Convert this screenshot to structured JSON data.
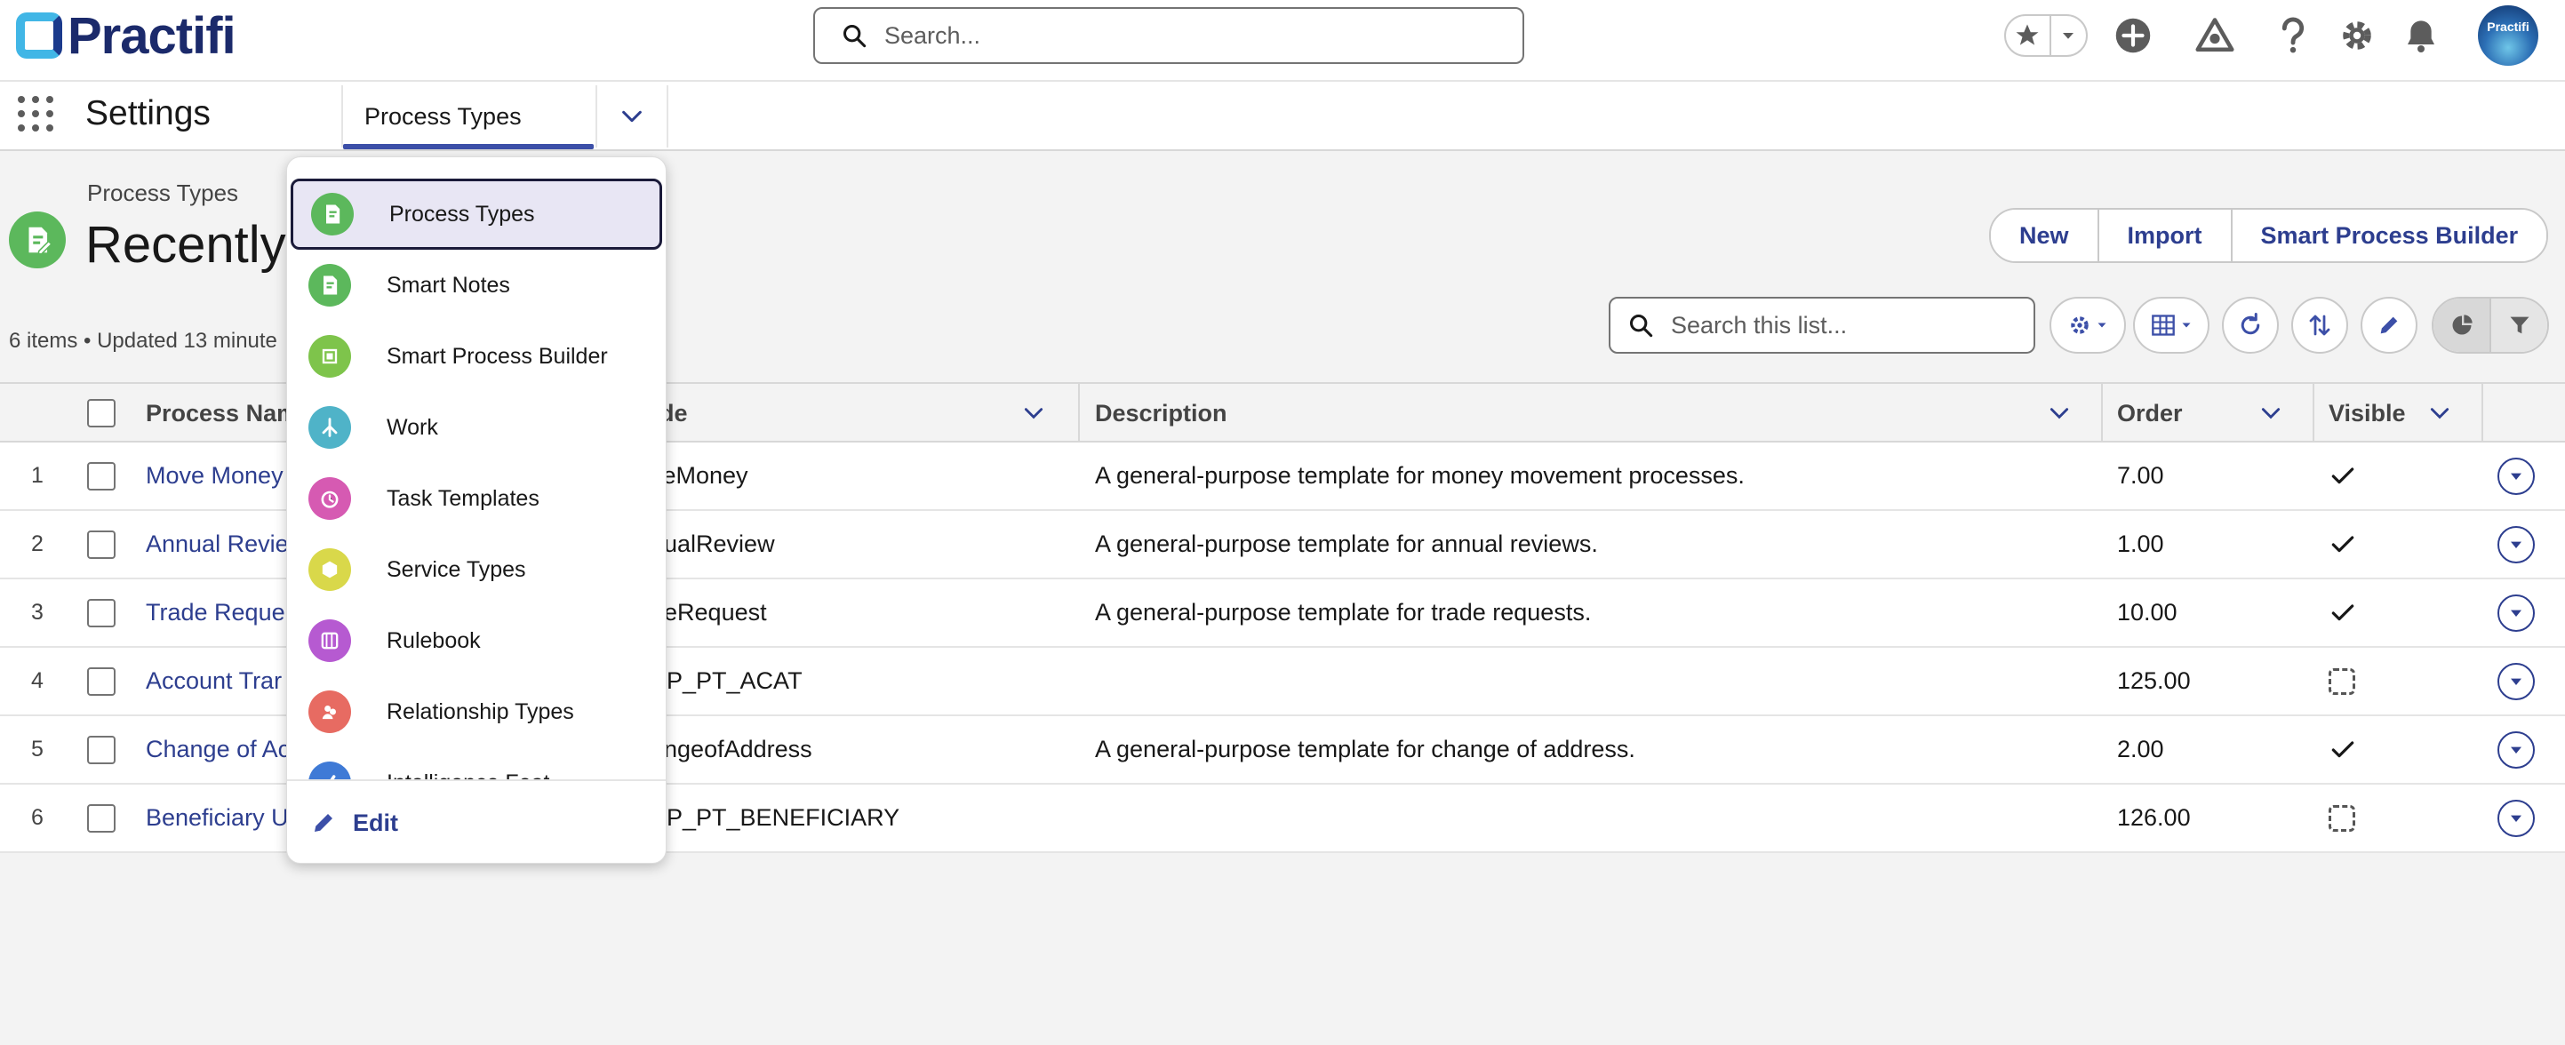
{
  "header": {
    "logo_text": "Practifi",
    "search_placeholder": "Search...",
    "avatar_text": "Practifi",
    "icons": [
      "favorites-star-icon",
      "favorites-dropdown-icon",
      "global-actions-icon",
      "trailhead-icon",
      "help-icon",
      "setup-gear-icon",
      "notifications-bell-icon"
    ]
  },
  "nav": {
    "app_name": "Settings",
    "tab_label": "Process Types"
  },
  "list": {
    "kicker": "Process Types",
    "title": "Recently",
    "meta": "6 items • Updated 13 minute",
    "buttons": {
      "new": "New",
      "import": "Import",
      "smart_builder": "Smart Process Builder"
    },
    "search_placeholder": "Search this list..."
  },
  "table": {
    "headers": {
      "name": "Process Nam",
      "code": "de",
      "description": "Description",
      "order": "Order",
      "visible": "Visible"
    },
    "rows": [
      {
        "num": "1",
        "name": "Move Money",
        "code": "veMoney",
        "description": "A general-purpose template for money movement processes.",
        "order": "7.00",
        "visible": true
      },
      {
        "num": "2",
        "name": "Annual Revie",
        "code": "nualReview",
        "description": "A general-purpose template for annual reviews.",
        "order": "1.00",
        "visible": true
      },
      {
        "num": "3",
        "name": "Trade Reque",
        "code": "deRequest",
        "description": "A general-purpose template for trade requests.",
        "order": "10.00",
        "visible": true
      },
      {
        "num": "4",
        "name": "Account Trar",
        "code": "VP_PT_ACAT",
        "description": "",
        "order": "125.00",
        "visible": false
      },
      {
        "num": "5",
        "name": "Change of Ac",
        "code": "angeofAddress",
        "description": "A general-purpose template for change of address.",
        "order": "2.00",
        "visible": true
      },
      {
        "num": "6",
        "name": "Beneficiary U",
        "code": "VP_PT_BENEFICIARY",
        "description": "",
        "order": "126.00",
        "visible": false
      }
    ]
  },
  "dropdown": {
    "items": [
      {
        "label": "Process Types",
        "icon": "process-types-icon",
        "color": "#5cb85c"
      },
      {
        "label": "Smart Notes",
        "icon": "smart-notes-icon",
        "color": "#5cb85c"
      },
      {
        "label": "Smart Process Builder",
        "icon": "smart-process-builder-icon",
        "color": "#7ec44b"
      },
      {
        "label": "Work",
        "icon": "work-icon",
        "color": "#4fb3c8"
      },
      {
        "label": "Task Templates",
        "icon": "task-templates-icon",
        "color": "#d65ab2"
      },
      {
        "label": "Service Types",
        "icon": "service-types-icon",
        "color": "#d9d84a"
      },
      {
        "label": "Rulebook",
        "icon": "rulebook-icon",
        "color": "#b65ad1"
      },
      {
        "label": "Relationship Types",
        "icon": "relationship-types-icon",
        "color": "#e76b62"
      },
      {
        "label": "Intelligence Feat...",
        "icon": "intelligence-icon",
        "color": "#3f7ad6"
      }
    ],
    "edit_label": "Edit"
  }
}
